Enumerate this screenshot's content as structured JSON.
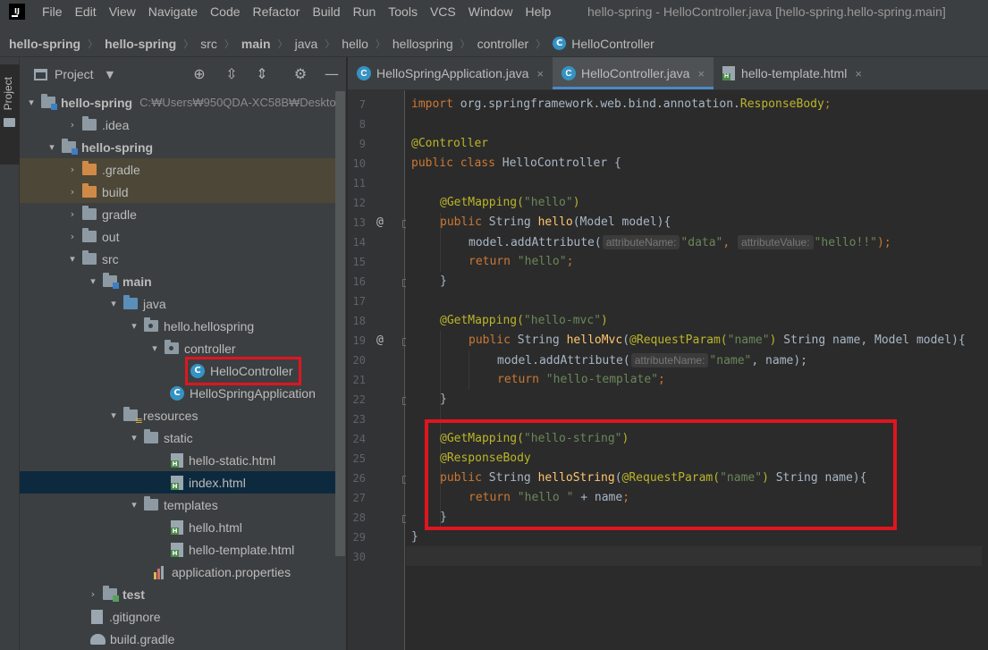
{
  "menubar": {
    "items": [
      "File",
      "Edit",
      "View",
      "Navigate",
      "Code",
      "Refactor",
      "Build",
      "Run",
      "Tools",
      "VCS",
      "Window",
      "Help"
    ],
    "window_title": "hello-spring - HelloController.java [hello-spring.hello-spring.main]"
  },
  "breadcrumb": [
    "hello-spring",
    "hello-spring",
    "src",
    "main",
    "java",
    "hello",
    "hellospring",
    "controller",
    "HelloController"
  ],
  "side_strip": {
    "label": "Project"
  },
  "project_panel": {
    "title": "Project",
    "tree": [
      {
        "label": "hello-spring",
        "hint": "C:₩Users₩950QDA-XC58B₩Deskto",
        "icon": "module-folder-icon"
      },
      {
        "label": ".idea",
        "icon": "folder-icon"
      },
      {
        "label": "hello-spring",
        "icon": "module-folder-icon"
      },
      {
        "label": ".gradle",
        "icon": "excluded-folder-icon"
      },
      {
        "label": "build",
        "icon": "excluded-folder-icon"
      },
      {
        "label": "gradle",
        "icon": "folder-icon"
      },
      {
        "label": "out",
        "icon": "folder-icon"
      },
      {
        "label": "src",
        "icon": "folder-icon"
      },
      {
        "label": "main",
        "icon": "source-root-icon"
      },
      {
        "label": "java",
        "icon": "java-folder-icon"
      },
      {
        "label": "hello.hellospring",
        "icon": "package-icon"
      },
      {
        "label": "controller",
        "icon": "package-icon"
      },
      {
        "label": "HelloController",
        "icon": "class-icon"
      },
      {
        "label": "HelloSpringApplication",
        "icon": "spring-app-class-icon"
      },
      {
        "label": "resources",
        "icon": "resources-folder-icon"
      },
      {
        "label": "static",
        "icon": "folder-icon"
      },
      {
        "label": "hello-static.html",
        "icon": "html-file-icon"
      },
      {
        "label": "index.html",
        "icon": "html-file-icon"
      },
      {
        "label": "templates",
        "icon": "folder-icon"
      },
      {
        "label": "hello.html",
        "icon": "html-file-icon"
      },
      {
        "label": "hello-template.html",
        "icon": "html-file-icon"
      },
      {
        "label": "application.properties",
        "icon": "properties-file-icon"
      },
      {
        "label": "test",
        "icon": "test-folder-icon"
      },
      {
        "label": ".gitignore",
        "icon": "gitignore-file-icon"
      },
      {
        "label": "build.gradle",
        "icon": "gradle-file-icon"
      }
    ]
  },
  "editor_tabs": [
    {
      "label": "HelloSpringApplication.java",
      "close": "×"
    },
    {
      "label": "HelloController.java",
      "close": "×"
    },
    {
      "label": "hello-template.html",
      "close": "×"
    }
  ],
  "editor": {
    "line_numbers": [
      "7",
      "8",
      "9",
      "10",
      "11",
      "12",
      "13",
      "14",
      "15",
      "16",
      "17",
      "18",
      "19",
      "20",
      "21",
      "22",
      "23",
      "24",
      "25",
      "26",
      "27",
      "28",
      "29",
      "30"
    ],
    "gutter_marks": {
      "13": "@",
      "19": "@"
    },
    "hints": {
      "attributeName": "attributeName:",
      "attributeValue": "attributeValue:"
    },
    "code": {
      "l7_kw": "import",
      "l7_pkg": " org.springframework.web.bind.annotation.",
      "l7_cls": "ResponseBody",
      "l7_end": ";",
      "l9": "@Controller",
      "l10_kw": "public class",
      "l10_rest": " HelloController {",
      "l12_ann": "@GetMapping(",
      "l12_str": "\"hello\"",
      "l12_end": ")",
      "l13_kw": "public",
      "l13_t": " String ",
      "l13_fn": "hello",
      "l13_rest": "(Model model){",
      "l14_a": "model.addAttribute(",
      "l14_s1": "\"data\"",
      "l14_comma": ",",
      "l14_s2": "\"hello!!\"",
      "l14_end": ");",
      "l15_kw": "return",
      "l15_str": " \"hello\"",
      "l15_end": ";",
      "l16": "}",
      "l18_ann": "@GetMapping(",
      "l18_str": "\"hello-mvc\"",
      "l18_end": ")",
      "l19_kw": "public",
      "l19_t": " String ",
      "l19_fn": "helloMvc",
      "l19_p": "(",
      "l19_ann": "@RequestParam(",
      "l19_str": "\"name\"",
      "l19_ann_end": ")",
      "l19_rest": " String name, Model model){",
      "l20_a": "model.addAttribute(",
      "l20_s": "\"name\"",
      "l20_rest": ", name);",
      "l21_kw": "return",
      "l21_str": " \"hello-template\"",
      "l21_end": ";",
      "l22": "}",
      "l24_ann": "@GetMapping(",
      "l24_str": "\"hello-string\"",
      "l24_end": ")",
      "l25": "@ResponseBody",
      "l26_kw": "public",
      "l26_t": " String ",
      "l26_fn": "helloString",
      "l26_p": "(",
      "l26_ann": "@RequestParam(",
      "l26_str": "\"name\"",
      "l26_ann_end": ")",
      "l26_rest": " String name){",
      "l27_kw": "return",
      "l27_str": " \"hello \"",
      "l27_rest": " + name",
      "l27_end": ";",
      "l28": "}",
      "l29": "}"
    }
  },
  "colors": {
    "highlight_box": "#e0151f",
    "keyword": "#cc7832",
    "annotation": "#bbb529",
    "string": "#6a8759",
    "method": "#ffc66d",
    "text": "#a9b7c6",
    "class_icon": "#3592c4"
  }
}
